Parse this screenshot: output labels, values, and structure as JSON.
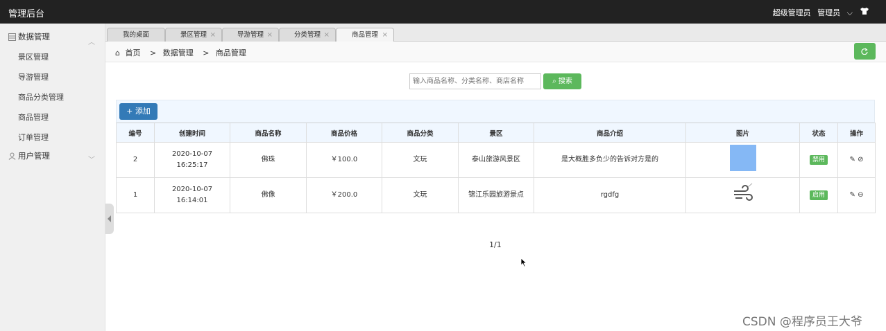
{
  "header": {
    "brand": "管理后台",
    "role": "超级管理员",
    "user": "管理员"
  },
  "sidebar": {
    "groups": [
      {
        "label": "数据管理",
        "items": [
          "景区管理",
          "导游管理",
          "商品分类管理",
          "商品管理",
          "订单管理"
        ]
      },
      {
        "label": "用户管理",
        "items": []
      }
    ]
  },
  "tabs": [
    "我的桌面",
    "景区管理",
    "导游管理",
    "分类管理",
    "商品管理"
  ],
  "breadcrumb": {
    "home": "首页",
    "sep": ">",
    "level1": "数据管理",
    "level2": "商品管理"
  },
  "search": {
    "placeholder": "输入商品名称、分类名称、商店名称",
    "button": "搜索"
  },
  "toolbar": {
    "add": "添加"
  },
  "table": {
    "headers": [
      "编号",
      "创建时间",
      "商品名称",
      "商品价格",
      "商品分类",
      "景区",
      "商品介绍",
      "图片",
      "状态",
      "操作"
    ],
    "rows": [
      {
        "id": "2",
        "time": "2020-10-07 16:25:17",
        "name": "佛珠",
        "price": "￥100.0",
        "category": "文玩",
        "scenic": "泰山旅游风景区",
        "intro": "是大概胜多负少的告诉对方是的",
        "status": "禁用"
      },
      {
        "id": "1",
        "time": "2020-10-07 16:14:01",
        "name": "佛像",
        "price": "￥200.0",
        "category": "文玩",
        "scenic": "锦江乐园旅游景点",
        "intro": "rgdfg",
        "status": "启用"
      }
    ]
  },
  "pager": "1/1",
  "watermark": "CSDN @程序员王大爷",
  "colors": {
    "topbar": "#222222",
    "green": "#5cb85c",
    "blue": "#337ab7"
  }
}
